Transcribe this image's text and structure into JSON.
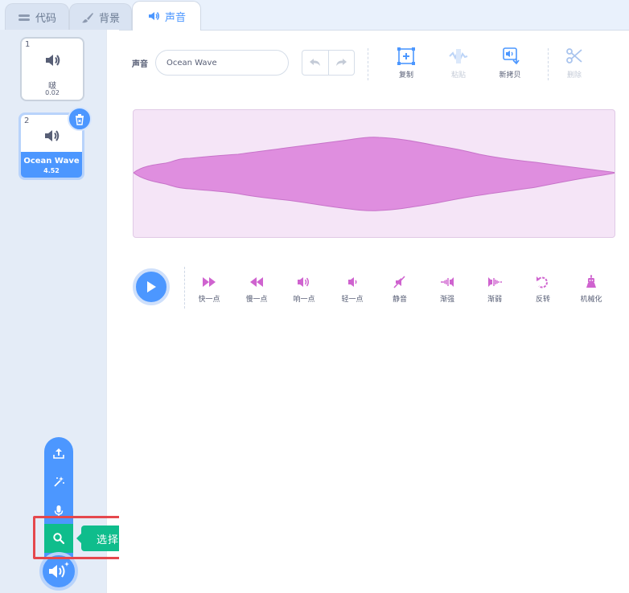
{
  "tabs": [
    {
      "label": "代码",
      "icon": "code-icon"
    },
    {
      "label": "背景",
      "icon": "brush-icon"
    },
    {
      "label": "声音",
      "icon": "speaker-icon",
      "active": true
    }
  ],
  "sounds": [
    {
      "index": "1",
      "name": "啵",
      "duration": "0.02"
    },
    {
      "index": "2",
      "name": "Ocean Wave",
      "duration": "4.52",
      "selected": true
    }
  ],
  "add_menu": {
    "tooltip": "选择一个声音",
    "items": [
      "upload-icon",
      "surprise-icon",
      "microphone-icon",
      "search-icon"
    ]
  },
  "editor": {
    "sound_label": "声音",
    "sound_name": "Ocean Wave",
    "tools": [
      {
        "label": "复制",
        "enabled": true
      },
      {
        "label": "粘贴",
        "enabled": false
      },
      {
        "label": "新拷贝",
        "enabled": true
      },
      {
        "label": "删除",
        "enabled": false
      }
    ],
    "effects": [
      "快一点",
      "慢一点",
      "响一点",
      "轻一点",
      "静音",
      "渐强",
      "渐弱",
      "反转",
      "机械化"
    ]
  },
  "colors": {
    "accent": "#4c97ff",
    "sound_effect": "#cf63cf",
    "waveform_fill": "#df8edf",
    "waveform_bg": "#f5e5f7",
    "add_search": "#0fbd8c",
    "highlight": "#e5484d"
  }
}
